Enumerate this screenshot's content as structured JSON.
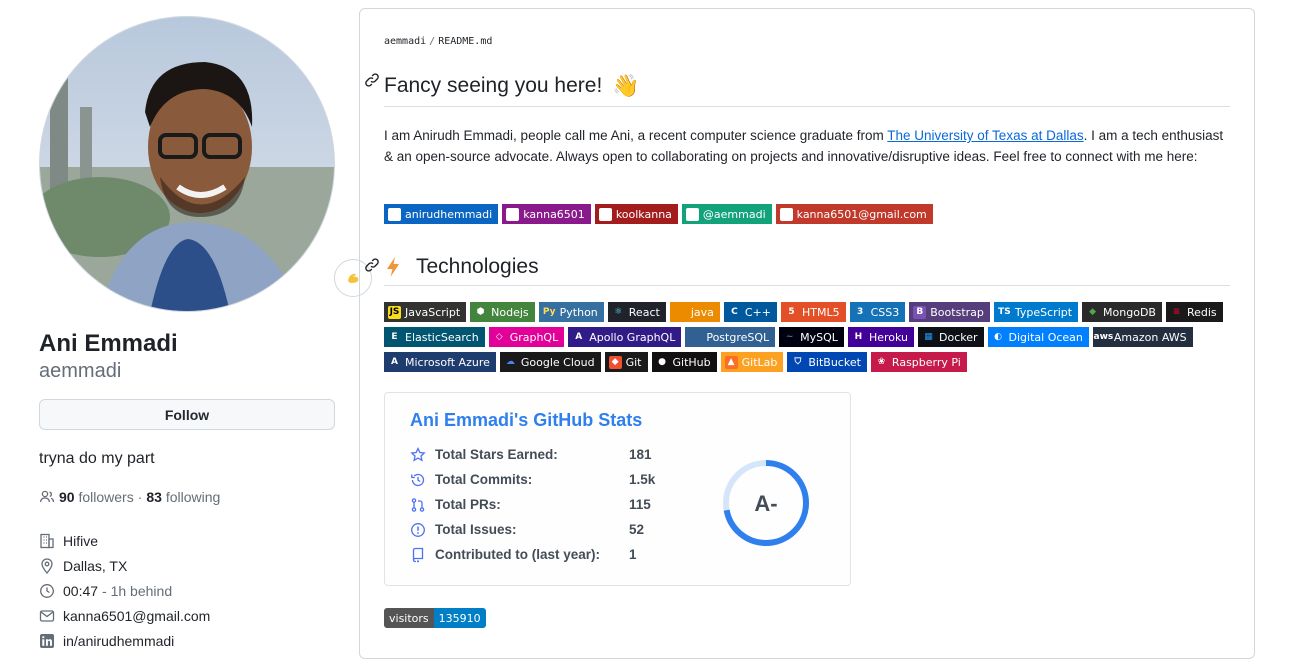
{
  "profile": {
    "name": "Ani Emmadi",
    "login": "aemmadi",
    "follow_label": "Follow",
    "bio": "tryna do my part",
    "followers_count": "90",
    "followers_label": "followers",
    "following_count": "83",
    "following_label": "following",
    "separator": "·",
    "company": "Hifive",
    "location": "Dallas, TX",
    "local_time": "00:47",
    "time_offset": "- 1h behind",
    "email": "kanna6501@gmail.com",
    "linkedin": "in/anirudhemmadi"
  },
  "readme": {
    "path_user": "aemmadi",
    "path_sep": "/",
    "path_file": "README.md",
    "greeting_heading": "Fancy seeing you here!",
    "greeting_emoji": "👋",
    "intro_part1": "I am Anirudh Emmadi, people call me Ani, a recent computer science graduate from ",
    "intro_link": "The University of Texas at Dallas",
    "intro_part2": ". I am a tech enthusiast & an open-source advocate. Always open to collaborating on projects and innovative/disruptive ideas. Feel free to connect with me here:",
    "social_badges": [
      {
        "label": "anirudhemmadi",
        "color": "#0a66c2",
        "icon": "linkedin-icon"
      },
      {
        "label": "kanna6501",
        "color": "#8a1a8c",
        "icon": "instagram-icon"
      },
      {
        "label": "koolkanna",
        "color": "#a31d1d",
        "icon": "youtube-icon"
      },
      {
        "label": "@aemmadi",
        "color": "#12a37b",
        "icon": "medium-icon"
      },
      {
        "label": "kanna6501@gmail.com",
        "color": "#c0392b",
        "icon": "gmail-icon"
      }
    ],
    "tech_heading": "Technologies",
    "tech_rows": [
      [
        {
          "label": "JavaScript",
          "color": "#323330",
          "logo_bg": "#f7df1e",
          "logo_fg": "#000000",
          "glyph": "JS"
        },
        {
          "label": "Nodejs",
          "color": "#43853d",
          "logo_bg": "#43853d",
          "logo_fg": "#ffffff",
          "glyph": "⬢"
        },
        {
          "label": "Python",
          "color": "#3670a0",
          "logo_bg": "#3670a0",
          "logo_fg": "#ffdd54",
          "glyph": "Py"
        },
        {
          "label": "React",
          "color": "#20232a",
          "logo_bg": "#20232a",
          "logo_fg": "#61dafb",
          "glyph": "⚛"
        },
        {
          "label": "java",
          "color": "#ed8b00",
          "logo_bg": "#ed8b00",
          "logo_fg": "#ffffff",
          "glyph": ""
        },
        {
          "label": "C++",
          "color": "#00599c",
          "logo_bg": "#00599c",
          "logo_fg": "#ffffff",
          "glyph": "C"
        },
        {
          "label": "HTML5",
          "color": "#e34f26",
          "logo_bg": "#e34f26",
          "logo_fg": "#ffffff",
          "glyph": "5"
        },
        {
          "label": "CSS3",
          "color": "#1572b6",
          "logo_bg": "#1572b6",
          "logo_fg": "#ffffff",
          "glyph": "3"
        },
        {
          "label": "Bootstrap",
          "color": "#563d7c",
          "logo_bg": "#7952b3",
          "logo_fg": "#ffffff",
          "glyph": "B"
        },
        {
          "label": "TypeScript",
          "color": "#007acc",
          "logo_bg": "#007acc",
          "logo_fg": "#ffffff",
          "glyph": "TS"
        },
        {
          "label": "MongoDB",
          "color": "#2a2a2a",
          "logo_bg": "#2a2a2a",
          "logo_fg": "#4ea94b",
          "glyph": "◆"
        },
        {
          "label": "Redis",
          "color": "#1a1a1a",
          "logo_bg": "#1a1a1a",
          "logo_fg": "#dd0031",
          "glyph": "≡"
        }
      ],
      [
        {
          "label": "ElasticSearch",
          "color": "#005571",
          "logo_bg": "#005571",
          "logo_fg": "#ffffff",
          "glyph": "E"
        },
        {
          "label": "GraphQL",
          "color": "#e10098",
          "logo_bg": "#e10098",
          "logo_fg": "#ffffff",
          "glyph": "◇"
        },
        {
          "label": "Apollo GraphQL",
          "color": "#311c87",
          "logo_bg": "#311c87",
          "logo_fg": "#ffffff",
          "glyph": "A"
        },
        {
          "label": "PostgreSQL",
          "color": "#316192",
          "logo_bg": "#316192",
          "logo_fg": "#ffffff",
          "glyph": ""
        },
        {
          "label": "MySQL",
          "color": "#00000f",
          "logo_bg": "#00000f",
          "logo_fg": "#4479a1",
          "glyph": "~"
        },
        {
          "label": "Heroku",
          "color": "#430098",
          "logo_bg": "#430098",
          "logo_fg": "#ffffff",
          "glyph": "H"
        },
        {
          "label": "Docker",
          "color": "#0d1117",
          "logo_bg": "#0d1117",
          "logo_fg": "#2496ed",
          "glyph": "▦"
        },
        {
          "label": "Digital Ocean",
          "color": "#0080ff",
          "logo_bg": "#0080ff",
          "logo_fg": "#ffffff",
          "glyph": "◐"
        },
        {
          "label": "Amazon AWS",
          "color": "#232f3e",
          "logo_bg": "#232f3e",
          "logo_fg": "#ffffff",
          "glyph": "aws"
        }
      ],
      [
        {
          "label": "Microsoft Azure",
          "color": "#1f3c6e",
          "logo_bg": "#1f3c6e",
          "logo_fg": "#ffffff",
          "glyph": "A"
        },
        {
          "label": "Google Cloud",
          "color": "#1a1a1a",
          "logo_bg": "#1a1a1a",
          "logo_fg": "#4285f4",
          "glyph": "☁"
        },
        {
          "label": "Git",
          "color": "#1a1a1a",
          "logo_bg": "#f05032",
          "logo_fg": "#ffffff",
          "glyph": "◆"
        },
        {
          "label": "GitHub",
          "color": "#121011",
          "logo_bg": "#121011",
          "logo_fg": "#ffffff",
          "glyph": "●"
        },
        {
          "label": "GitLab",
          "color": "#fca121",
          "logo_bg": "#fc6d26",
          "logo_fg": "#ffffff",
          "glyph": "▲"
        },
        {
          "label": "BitBucket",
          "color": "#0047b3",
          "logo_bg": "#0047b3",
          "logo_fg": "#ffffff",
          "glyph": "⛉"
        },
        {
          "label": "Raspberry Pi",
          "color": "#c51a4a",
          "logo_bg": "#c51a4a",
          "logo_fg": "#ffffff",
          "glyph": "❀"
        }
      ]
    ],
    "stats": {
      "title": "Ani Emmadi's GitHub Stats",
      "rows": [
        {
          "label": "Total Stars Earned:",
          "value": "181",
          "icon": "star-icon"
        },
        {
          "label": "Total Commits:",
          "value": "1.5k",
          "icon": "history-icon"
        },
        {
          "label": "Total PRs:",
          "value": "115",
          "icon": "pull-request-icon"
        },
        {
          "label": "Total Issues:",
          "value": "52",
          "icon": "issue-icon"
        },
        {
          "label": "Contributed to (last year):",
          "value": "1",
          "icon": "repo-icon"
        }
      ],
      "rank": "A-",
      "rank_progress": 0.72,
      "accent": "#2f80ed"
    },
    "visitors": {
      "label": "visitors",
      "count": "135910"
    }
  }
}
